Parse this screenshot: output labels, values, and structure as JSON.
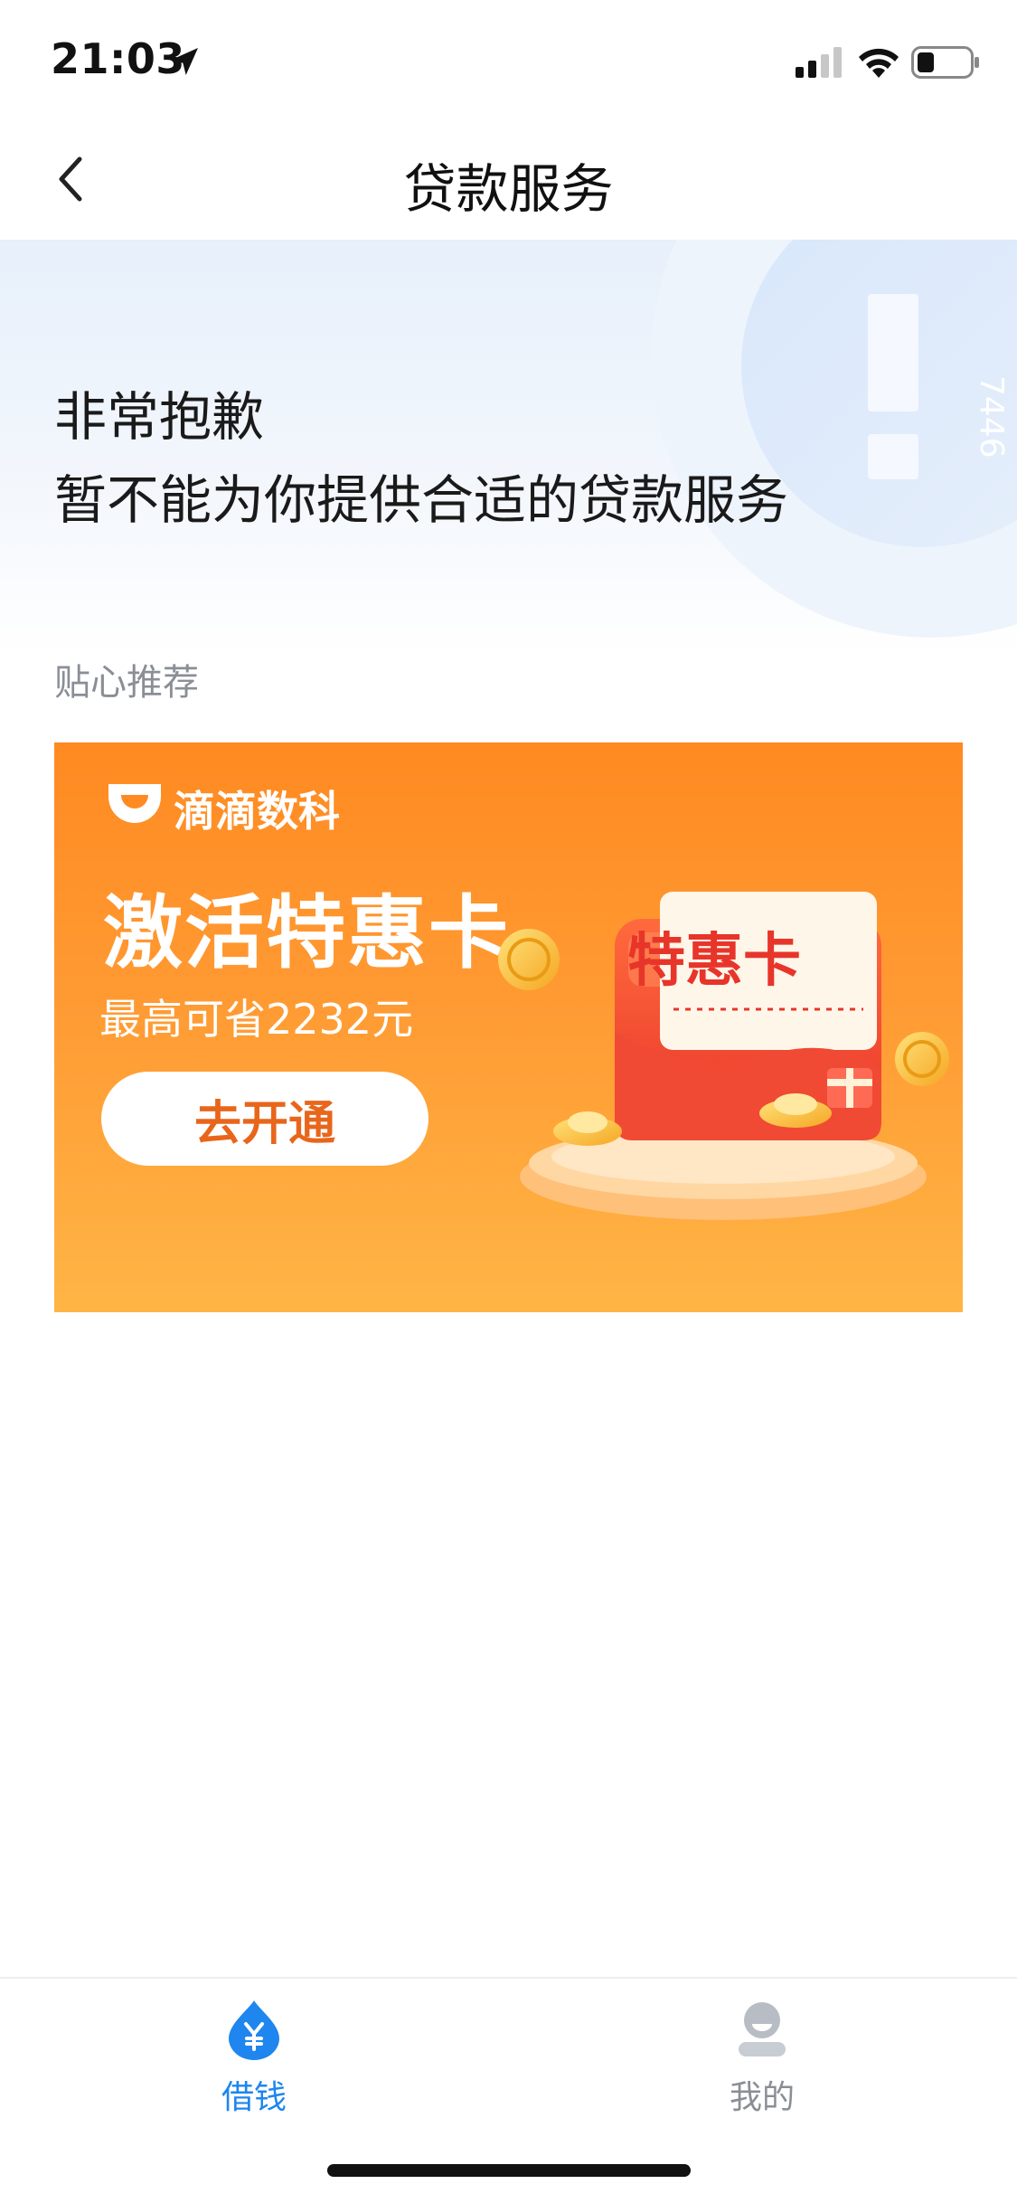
{
  "status_bar": {
    "time": "21:03",
    "icons": [
      "location-arrow-icon",
      "signal-icon",
      "wifi-icon",
      "battery-icon"
    ]
  },
  "nav": {
    "title": "贷款服务",
    "back_icon": "chevron-left-icon"
  },
  "hero": {
    "line1": "非常抱歉",
    "line2": "暂不能为你提供合适的贷款服务",
    "decor_text": "7446"
  },
  "recommend": {
    "label": "贴心推荐"
  },
  "promo": {
    "brand_name": "滴滴数科",
    "title": "激活特惠卡",
    "subtitle": "最高可省2232元",
    "button_label": "去开通",
    "card_label": "特惠卡",
    "colors": {
      "banner_top": "#ff8a21",
      "banner_bottom": "#ffb545",
      "button_text": "#e8661b",
      "card_text": "#e8352a"
    }
  },
  "tabs": [
    {
      "label": "借钱",
      "icon": "yuan-drop-icon",
      "active": true
    },
    {
      "label": "我的",
      "icon": "profile-icon",
      "active": false
    }
  ],
  "colors": {
    "accent": "#1e86ee",
    "muted": "#8a8e96"
  }
}
